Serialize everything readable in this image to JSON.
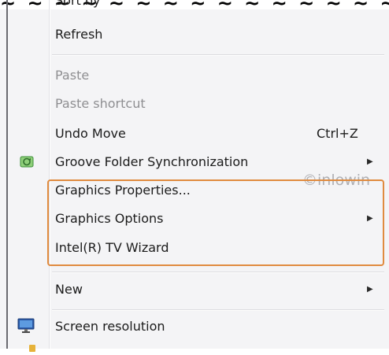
{
  "top_partial_text": "Sort by",
  "menu": {
    "refresh": "Refresh",
    "paste": "Paste",
    "paste_shortcut": "Paste shortcut",
    "undo_move": "Undo Move",
    "undo_shortcut": "Ctrl+Z",
    "groove": "Groove Folder Synchronization",
    "graphics_properties": "Graphics Properties...",
    "graphics_options": "Graphics Options",
    "intel_tv_wizard": "Intel(R) TV Wizard",
    "new": "New",
    "screen_resolution": "Screen resolution"
  },
  "watermark": "©inlowin",
  "icons": {
    "groove": "groove-icon",
    "screen": "monitor-icon",
    "submenu": "chevron-right-icon"
  },
  "colors": {
    "highlight": "#e08b3f",
    "disabled_text": "#8f8f92",
    "menu_bg": "#f4f4f6"
  }
}
